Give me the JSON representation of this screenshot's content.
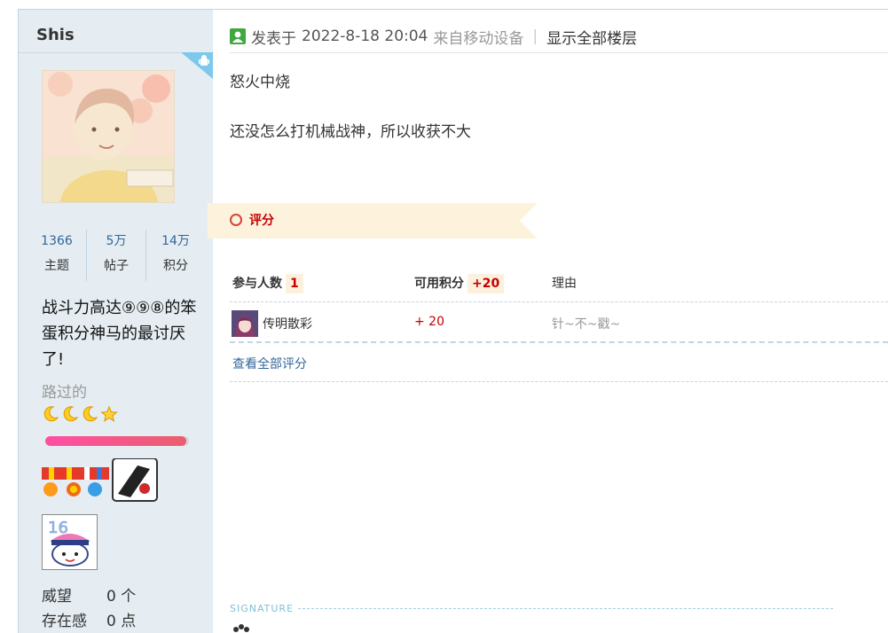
{
  "user": {
    "name": "Shis",
    "stats": [
      {
        "value": "1366",
        "label": "主题"
      },
      {
        "value": "5万",
        "label": "帖子"
      },
      {
        "value": "14万",
        "label": "积分"
      }
    ],
    "motto": "战斗力高达⑨⑨⑧的笨蛋积分神马的最讨厌了!",
    "group": "路过的",
    "progress": 0.98,
    "props": [
      {
        "label": "威望",
        "value": "0 个"
      },
      {
        "label": "存在感",
        "value": "0 点"
      }
    ]
  },
  "post": {
    "posted_prefix": "发表于",
    "datetime": "2022-8-18 20:04",
    "source": "来自移动设备",
    "separator": "|",
    "show_all_floors": "显示全部楼层",
    "lines": [
      "怒火中烧",
      "还没怎么打机械战神，所以收获不大"
    ]
  },
  "rating": {
    "title": "评分",
    "header": {
      "participants_label": "参与人数",
      "participants_count": "1",
      "points_label": "可用积分",
      "points_value": "+20",
      "reason_label": "理由"
    },
    "rows": [
      {
        "user": "传明散彩",
        "points": "+ 20",
        "reason": "针~不~戳~"
      }
    ],
    "view_all": "查看全部评分"
  },
  "signature": {
    "label": "SIGNATURE"
  },
  "colors": {
    "link": "#336699",
    "sidebar_bg": "#e5edf2",
    "rating_red": "#c40000",
    "accent_green": "#3fa83f"
  }
}
